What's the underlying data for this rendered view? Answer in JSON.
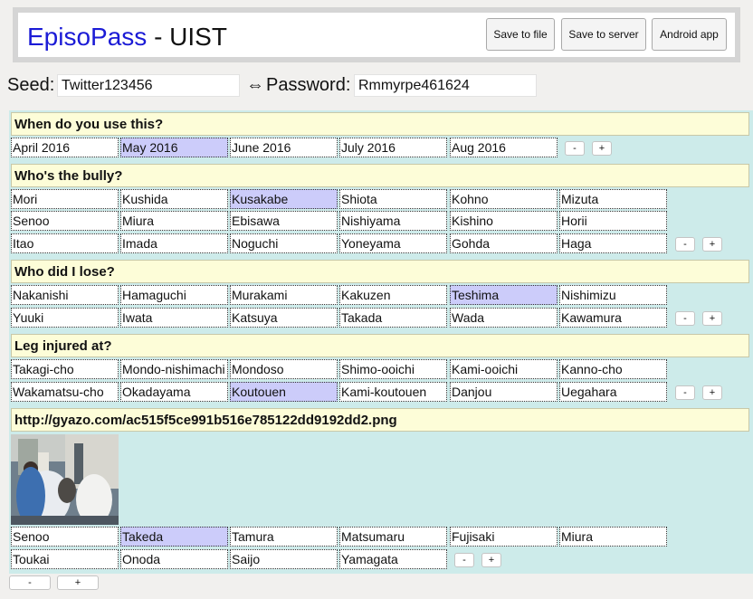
{
  "header": {
    "brand": "EpisoPass",
    "title_suffix": " - UIST",
    "buttons": [
      "Save to file",
      "Save to server",
      "Android app"
    ]
  },
  "seed": {
    "label": "Seed:",
    "value": "Twitter123456",
    "arrow": "⇔",
    "password_label": "Password:",
    "password_value": "Rmmyrpe461624"
  },
  "questions": [
    {
      "title": "When do you use this?",
      "rows": [
        [
          "April 2016",
          "May 2016",
          "June 2016",
          "July 2016",
          "Aug 2016"
        ]
      ],
      "selected": "May 2016"
    },
    {
      "title": "Who's the bully?",
      "rows": [
        [
          "Mori",
          "Kushida",
          "Kusakabe",
          "Shiota",
          "Kohno",
          "Mizuta"
        ],
        [
          "Senoo",
          "Miura",
          "Ebisawa",
          "Nishiyama",
          "Kishino",
          "Horii"
        ],
        [
          "Itao",
          "Imada",
          "Noguchi",
          "Yoneyama",
          "Gohda",
          "Haga"
        ]
      ],
      "selected": "Kusakabe"
    },
    {
      "title": "Who did I lose?",
      "rows": [
        [
          "Nakanishi",
          "Hamaguchi",
          "Murakami",
          "Kakuzen",
          "Teshima",
          "Nishimizu"
        ],
        [
          "Yuuki",
          "Iwata",
          "Katsuya",
          "Takada",
          "Wada",
          "Kawamura"
        ]
      ],
      "selected": "Teshima"
    },
    {
      "title": "Leg injured at?",
      "rows": [
        [
          "Takagi-cho",
          "Mondo-nishimachi",
          "Mondoso",
          "Shimo-ooichi",
          "Kami-ooichi",
          "Kanno-cho"
        ],
        [
          "Wakamatsu-cho",
          "Okadayama",
          "Koutouen",
          "Kami-koutouen",
          "Danjou",
          "Uegahara"
        ]
      ],
      "selected": "Koutouen"
    },
    {
      "title": "http://gyazo.com/ac515f5ce991b516e785122dd9192dd2.png",
      "rows": [
        [
          "Senoo",
          "Takeda",
          "Tamura",
          "Matsumaru",
          "Fujisaki",
          "Miura"
        ],
        [
          "Toukai",
          "Onoda",
          "Saijo",
          "Yamagata"
        ]
      ],
      "selected": "Takeda"
    }
  ],
  "controls": {
    "minus": "-",
    "plus": "+"
  }
}
